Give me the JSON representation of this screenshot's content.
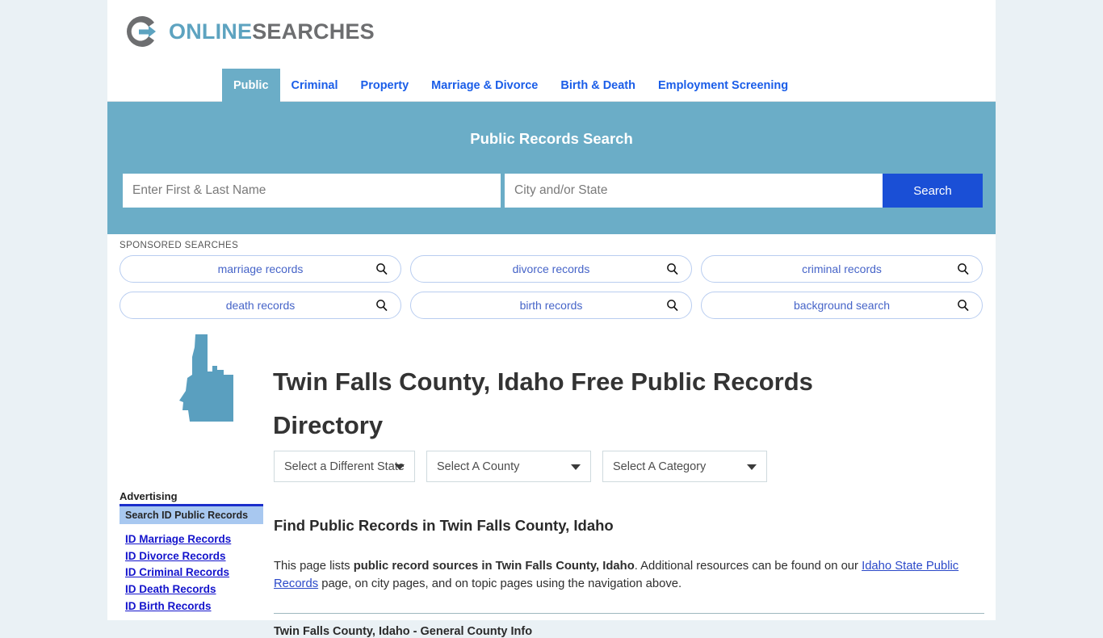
{
  "brand": {
    "name_part1": "ONLINE",
    "name_part2": "SEARCHES",
    "logo_icon": "circle-arrow-logo-icon",
    "accent_teal": "#6badc7",
    "accent_gray": "#6d6e70",
    "accent_blue": "#1a4fd6"
  },
  "nav": {
    "items": [
      {
        "label": "Public",
        "active": true
      },
      {
        "label": "Criminal",
        "active": false
      },
      {
        "label": "Property",
        "active": false
      },
      {
        "label": "Marriage & Divorce",
        "active": false
      },
      {
        "label": "Birth & Death",
        "active": false
      },
      {
        "label": "Employment Screening",
        "active": false
      }
    ]
  },
  "hero": {
    "title": "Public Records Search",
    "name_placeholder": "Enter First & Last Name",
    "name_value": "",
    "city_placeholder": "City and/or State",
    "city_value": "",
    "search_button": "Search"
  },
  "sponsored": {
    "label": "SPONSORED SEARCHES",
    "items": [
      {
        "label": "marriage records",
        "icon": "search-icon"
      },
      {
        "label": "divorce records",
        "icon": "search-icon"
      },
      {
        "label": "criminal records",
        "icon": "search-icon"
      },
      {
        "label": "death records",
        "icon": "search-icon"
      },
      {
        "label": "birth records",
        "icon": "search-icon"
      },
      {
        "label": "background search",
        "icon": "search-icon"
      }
    ]
  },
  "header": {
    "state_map_icon": "idaho-state-map-icon",
    "title": "Twin Falls County, Idaho Free Public Records Directory"
  },
  "selects": {
    "state": "Select a Different State",
    "county": "Select A County",
    "category": "Select A Category"
  },
  "sidebar": {
    "advertising_label": "Advertising",
    "panel_title": "Search ID Public Records",
    "links": [
      "ID Marriage Records",
      "ID Divorce Records",
      "ID Criminal Records",
      "ID Death Records",
      "ID Birth Records"
    ]
  },
  "main": {
    "heading": "Find Public Records in Twin Falls County, Idaho",
    "paragraph_1": "This page lists ",
    "paragraph_bold": "public record sources in Twin Falls County, Idaho",
    "paragraph_2": ". Additional resources can be found on our ",
    "paragraph_link": "Idaho State Public Records",
    "paragraph_3": " page, on city pages, and on topic pages using the navigation above.",
    "section_heading": "Twin Falls County, Idaho - General County Info"
  }
}
